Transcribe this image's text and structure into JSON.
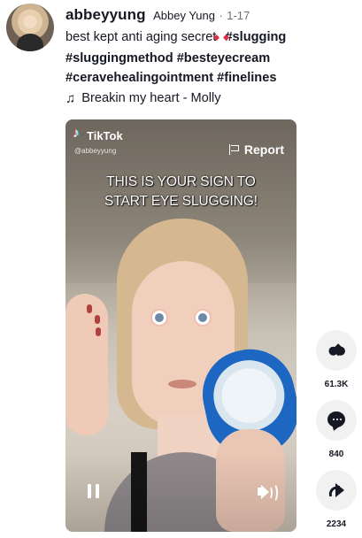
{
  "profile": {
    "username": "abbeyyung",
    "display_name": "Abbey Yung",
    "separator": "·",
    "date": "1-17"
  },
  "caption": {
    "text_before_emoji": "best kept anti aging secret",
    "emoji_name": "star-struck-emoji",
    "hashtags": [
      "#slugging",
      "#sluggingmethod",
      "#besteyecream",
      "#ceravehealingointment",
      "#finelines"
    ]
  },
  "music": {
    "title": "Breakin my heart - Molly",
    "icon": "music-note-icon"
  },
  "video": {
    "brand": "TikTok",
    "handle": "@abbeyyung",
    "report_label": "Report",
    "overlay_text_line1": "THIS IS YOUR SIGN TO",
    "overlay_text_line2": "START EYE SLUGGING!"
  },
  "actions": {
    "likes": "61.3K",
    "comments": "840",
    "shares": "2234"
  },
  "icons": {
    "like": "heart-icon",
    "comment": "comment-icon",
    "share": "share-icon",
    "report": "flag-icon",
    "pause": "pause-icon",
    "sound": "speaker-icon"
  }
}
